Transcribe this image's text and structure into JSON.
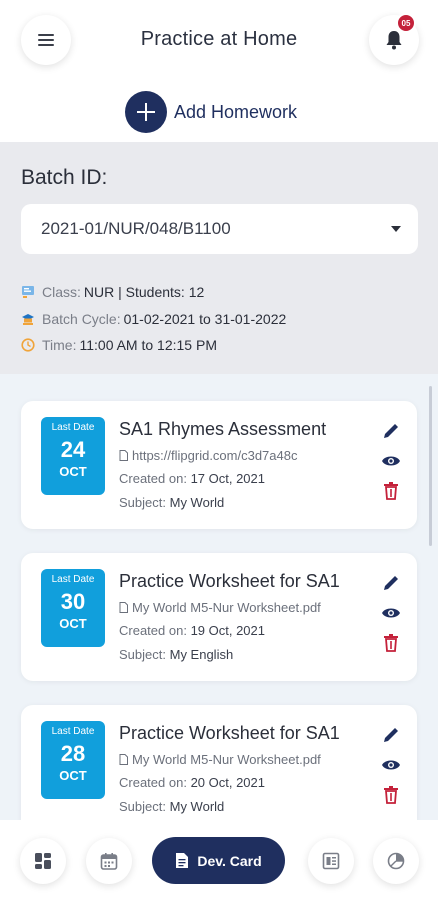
{
  "header": {
    "title": "Practice at Home",
    "notification_count": "05",
    "add_homework_label": "Add Homework"
  },
  "batch": {
    "label": "Batch ID:",
    "selected": "2021-01/NUR/048/B1100",
    "class_label": "Class:",
    "class_value": "NUR | Students: 12",
    "cycle_label": "Batch Cycle:",
    "cycle_value": "01-02-2021 to 31-01-2022",
    "time_label": "Time:",
    "time_value": "11:00 AM to 12:15 PM"
  },
  "homework": [
    {
      "last_date_label": "Last Date",
      "day": "24",
      "month": "OCT",
      "title": "SA1 Rhymes Assessment",
      "attachment": "https://flipgrid.com/c3d7a48c",
      "created_label": "Created on:",
      "created": "17 Oct, 2021",
      "subject_label": "Subject:",
      "subject": "My World"
    },
    {
      "last_date_label": "Last Date",
      "day": "30",
      "month": "OCT",
      "title": "Practice Worksheet for SA1",
      "attachment": "My World M5-Nur Worksheet.pdf",
      "created_label": "Created on:",
      "created": "19 Oct, 2021",
      "subject_label": "Subject:",
      "subject": "My English"
    },
    {
      "last_date_label": "Last Date",
      "day": "28",
      "month": "OCT",
      "title": "Practice Worksheet for SA1",
      "attachment": "My World M5-Nur Worksheet.pdf",
      "created_label": "Created on:",
      "created": "20 Oct, 2021",
      "subject_label": "Subject:",
      "subject": "My World"
    }
  ],
  "bottom_nav": {
    "dev_card_label": "Dev. Card"
  },
  "icons": {
    "menu": "hamburger-menu-icon",
    "bell": "bell-icon",
    "add": "plus-icon",
    "edit": "pencil-icon",
    "view": "eye-icon",
    "delete": "trash-icon",
    "attachment": "file-icon"
  },
  "colors": {
    "primary": "#1f2f5f",
    "date_badge": "#119fdc",
    "delete": "#c4213a",
    "badge": "#c4213a"
  }
}
